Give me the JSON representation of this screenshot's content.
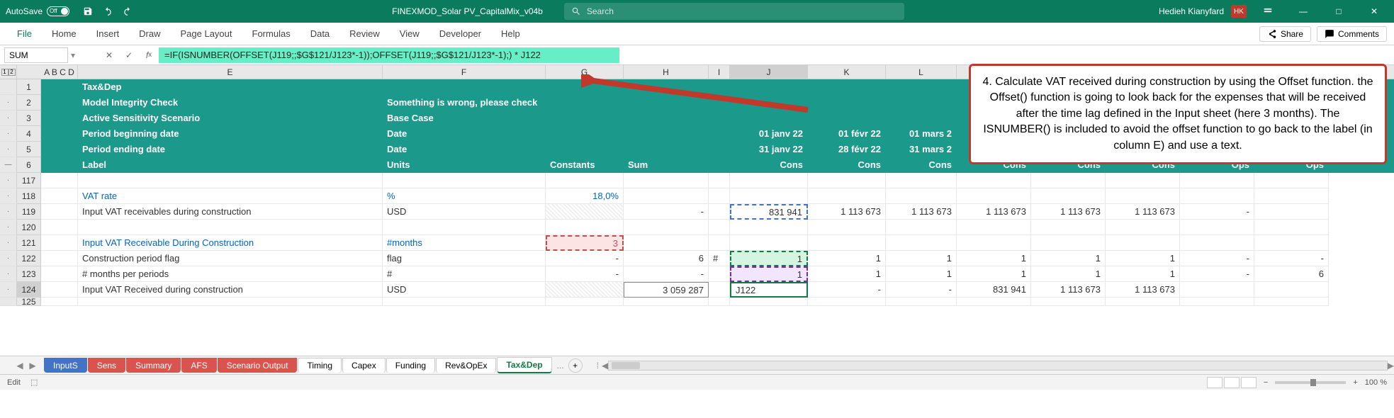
{
  "titlebar": {
    "autosave": "AutoSave",
    "autosave_state": "Off",
    "filename": "FINEXMOD_Solar PV_CapitalMix_v04b",
    "search_placeholder": "Search",
    "user_name": "Hedieh Kianyfard",
    "user_initials": "HK"
  },
  "ribbon": {
    "tabs": [
      "File",
      "Home",
      "Insert",
      "Draw",
      "Page Layout",
      "Formulas",
      "Data",
      "Review",
      "View",
      "Developer",
      "Help"
    ],
    "share": "Share",
    "comments": "Comments"
  },
  "formula_bar": {
    "name_box": "SUM",
    "formula": "=IF(ISNUMBER(OFFSET(J119;;$G$121/J123*-1));OFFSET(J119;;$G$121/J123*-1);) * J122"
  },
  "columns": [
    "A B C D",
    "E",
    "F",
    "G",
    "H",
    "I",
    "J",
    "K",
    "L",
    "",
    "",
    "",
    "",
    ""
  ],
  "rows": {
    "r1": {
      "e": "Tax&Dep"
    },
    "r2": {
      "e": "Model Integrity Check",
      "f": "Something is wrong, please check"
    },
    "r3": {
      "e": "Active Sensitivity Scenario",
      "f": "Base Case"
    },
    "r4": {
      "e": "Period beginning date",
      "f": "Date",
      "j": "01 janv 22",
      "k": "01 févr 22",
      "l": "01 mars 2"
    },
    "r5": {
      "e": "Period ending date",
      "f": "Date",
      "j": "31 janv 22",
      "k": "28 févr 22",
      "l": "31 mars 2"
    },
    "r6": {
      "e": "Label",
      "f": "Units",
      "g": "Constants",
      "h": "Sum",
      "j": "Cons",
      "k": "Cons",
      "l": "Cons",
      "m": "Cons",
      "n": "Cons",
      "o": "Cons",
      "p": "Ops",
      "q": "Ops"
    },
    "r117": {},
    "r118": {
      "e": "VAT rate",
      "f": "%",
      "g": "18,0%"
    },
    "r119": {
      "e": "Input VAT receivables during construction",
      "f": "USD",
      "h": "-",
      "j": "831 941",
      "k": "1 113 673",
      "l": "1 113 673",
      "m": "1 113 673",
      "n": "1 113 673",
      "o": "1 113 673",
      "p": "-"
    },
    "r120": {},
    "r121": {
      "e": "Input VAT Receivable During Construction",
      "f": "#months",
      "g": "3"
    },
    "r122": {
      "e": " Construction period flag",
      "f": "flag",
      "g": "-",
      "h": "6",
      "i": "#",
      "j": "1",
      "k": "1",
      "l": "1",
      "m": "1",
      "n": "1",
      "o": "1",
      "p": "-",
      "q": "-"
    },
    "r123": {
      "e": "# months per periods",
      "f": "#",
      "g": "-",
      "h": "-",
      "j": "1",
      "k": "1",
      "l": "1",
      "m": "1",
      "n": "1",
      "o": "1",
      "p": "-",
      "q": "6"
    },
    "r124": {
      "e": "Input VAT Received during construction",
      "f": "USD",
      "h": "3 059 287",
      "j": "J122",
      "k": "-",
      "l": "-",
      "m": "831 941",
      "n": "1 113 673",
      "o": "1 113 673"
    },
    "r125": {}
  },
  "row_nums": [
    "1",
    "2",
    "3",
    "4",
    "5",
    "6",
    "117",
    "118",
    "119",
    "120",
    "121",
    "122",
    "123",
    "124",
    "125"
  ],
  "sheet_tabs": {
    "items": [
      {
        "label": "InputS",
        "cls": "blue"
      },
      {
        "label": "Sens",
        "cls": "red"
      },
      {
        "label": "Summary",
        "cls": "red"
      },
      {
        "label": "AFS",
        "cls": "red"
      },
      {
        "label": "Scenario Output",
        "cls": "red"
      },
      {
        "label": "Timing",
        "cls": ""
      },
      {
        "label": "Capex",
        "cls": ""
      },
      {
        "label": "Funding",
        "cls": ""
      },
      {
        "label": "Rev&OpEx",
        "cls": ""
      },
      {
        "label": "Tax&Dep",
        "cls": "active"
      }
    ],
    "more": "..."
  },
  "status": {
    "mode": "Edit",
    "zoom": "100 %"
  },
  "callout": "4. Calculate VAT received during construction by using the Offset function. the Offset() function is going to look back for the expenses that will be received after the time lag defined in the Input sheet (here 3 months). The ISNUMBER() is included to avoid the offset function to go back to the label (in column E) and use a text."
}
